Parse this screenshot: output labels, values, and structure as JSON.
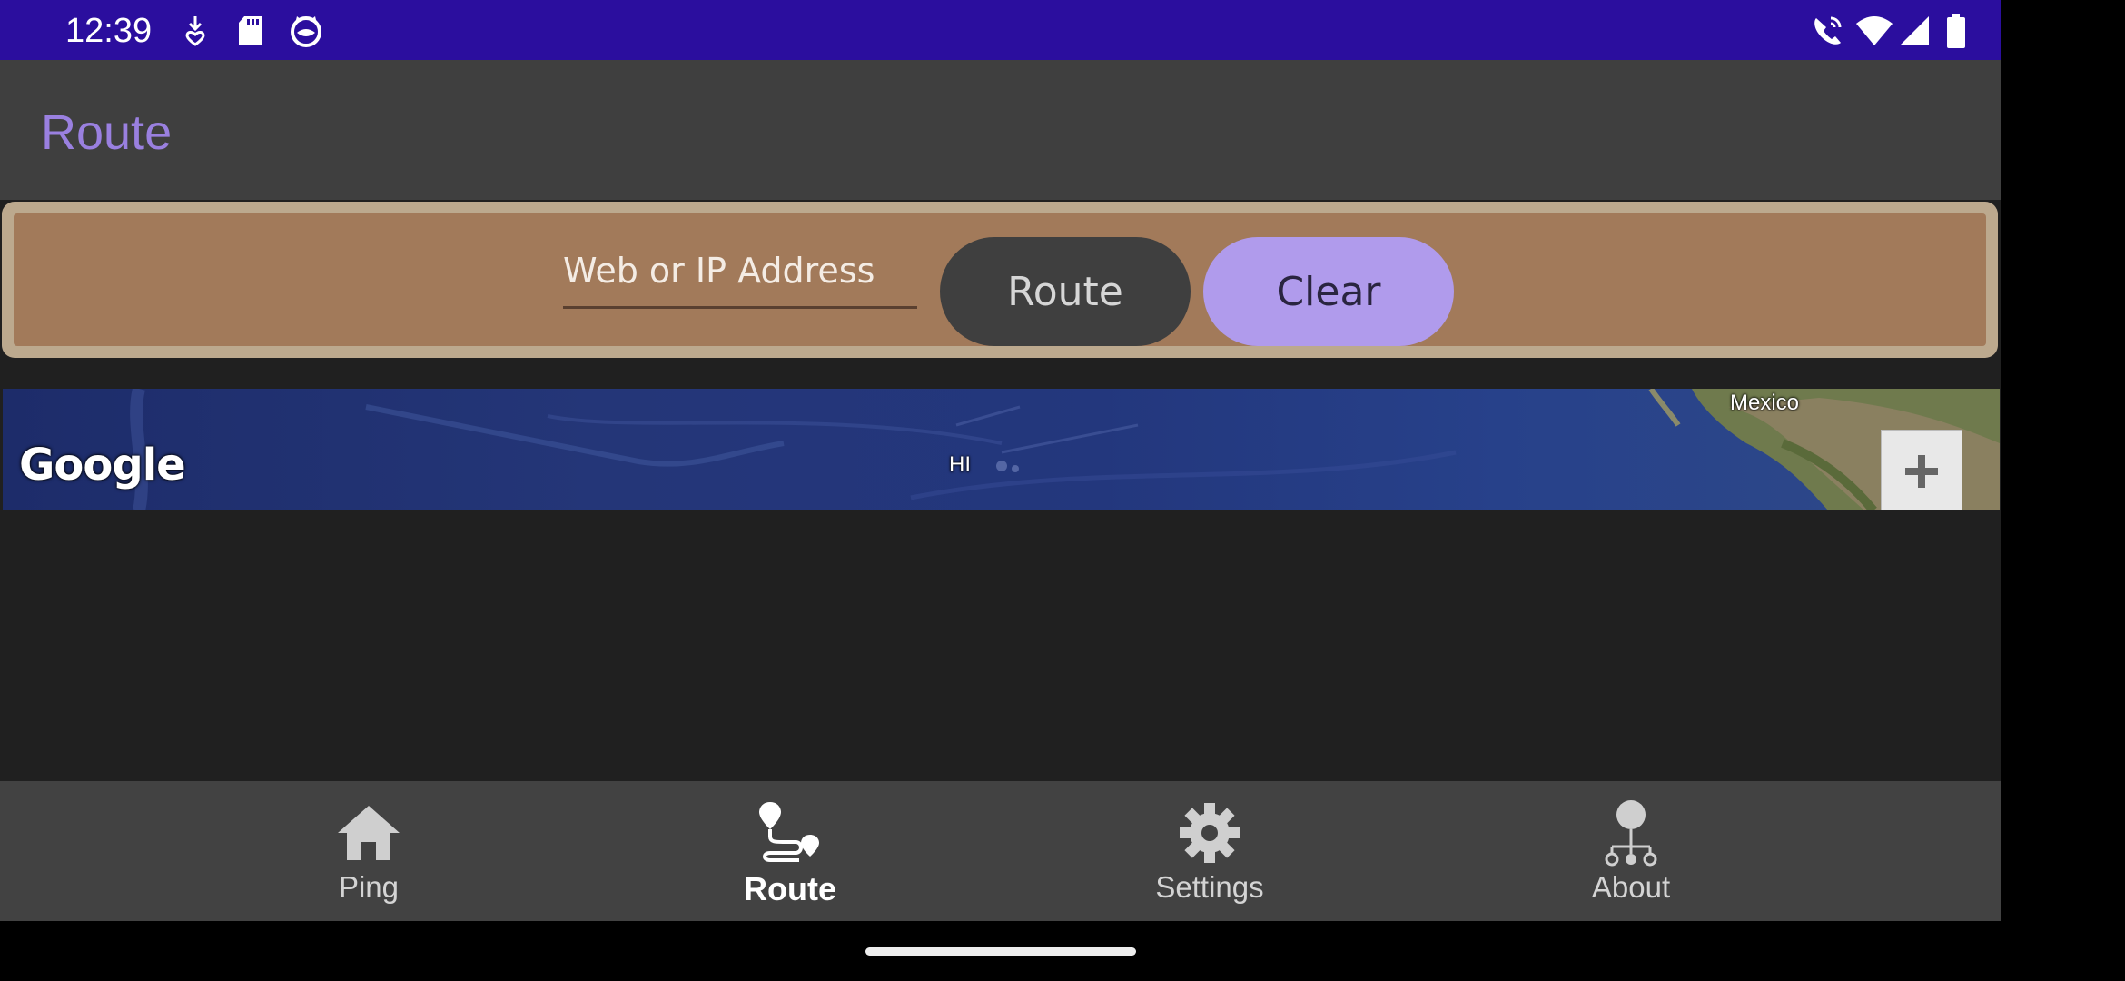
{
  "status_bar": {
    "time": "12:39",
    "left_icons": [
      "download-notification-icon",
      "sd-card-icon",
      "cat-face-icon"
    ],
    "right_icons": [
      "wifi-calling-icon",
      "wifi-icon",
      "cellular-signal-icon",
      "battery-icon"
    ],
    "background": "#2b0e9e"
  },
  "app_bar": {
    "title": "Route",
    "title_color": "#9a80e0"
  },
  "route_form": {
    "address_placeholder": "Web or IP Address",
    "address_value": "",
    "route_label": "Route",
    "clear_label": "Clear",
    "panel_color": "#a27a5a"
  },
  "map": {
    "provider_logo": "Google",
    "labels": {
      "hawaii": "HI",
      "mexico": "Mexico"
    },
    "zoom_in_label": "+"
  },
  "bottom_nav": {
    "items": [
      {
        "label": "Ping",
        "icon": "home-icon",
        "active": false
      },
      {
        "label": "Route",
        "icon": "route-icon",
        "active": true
      },
      {
        "label": "Settings",
        "icon": "gear-icon",
        "active": false
      },
      {
        "label": "About",
        "icon": "network-tree-icon",
        "active": false
      }
    ]
  }
}
